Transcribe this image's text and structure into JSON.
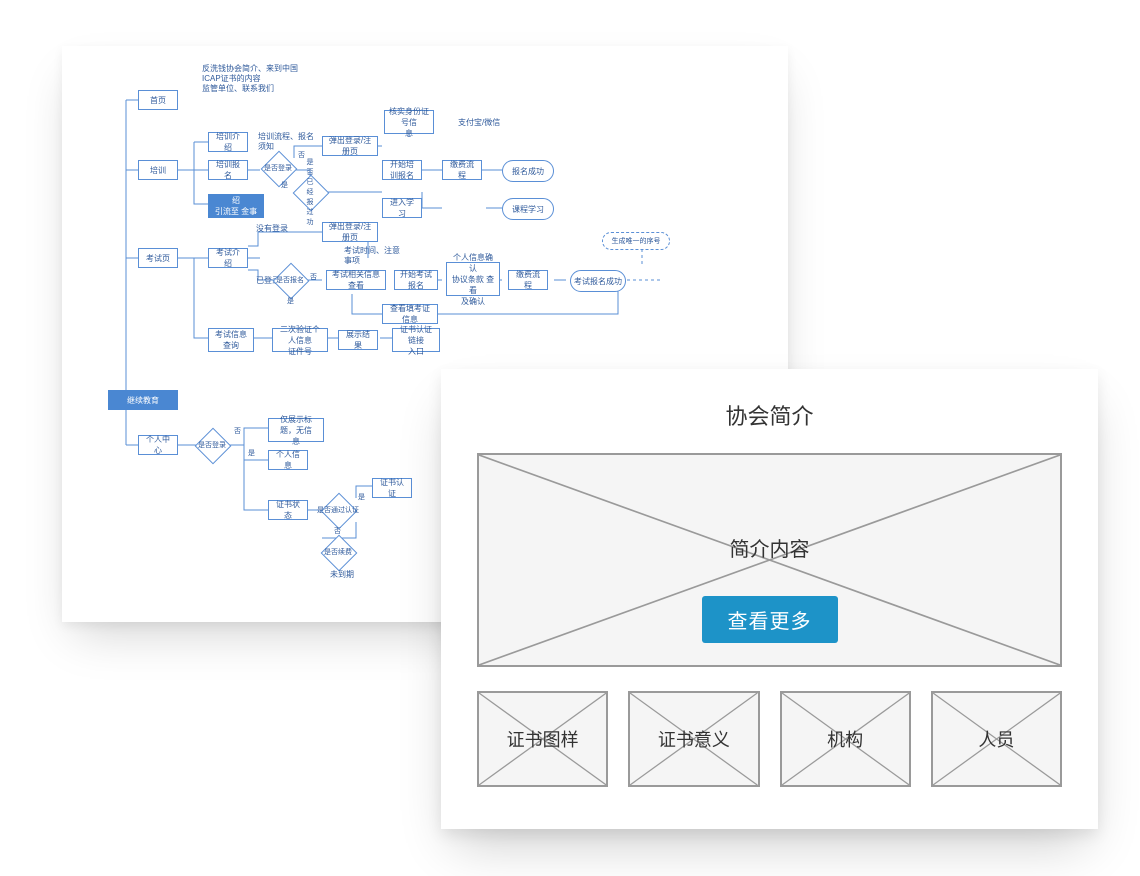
{
  "flowchart": {
    "note_top": "反洗钱协会简介、来到中国\nICAP证书的内容\n监管单位、联系我们",
    "nav": {
      "home": "首页",
      "training": "培训",
      "exam": "考试页",
      "continuing": "继续教育",
      "profile": "个人中心"
    },
    "training": {
      "intro": "培训介绍",
      "intro_note": "培训流程、报名\n须知",
      "signup": "培训报名",
      "is_login": "是否登录",
      "popup_login": "弹出登录/注册页",
      "has_signed": "是否已经报过\n功",
      "verify_id": "核实身份证号信\n息",
      "pay": "支付宝/微信",
      "start_train": "开始培训报名",
      "pay_flow": "缴费流程",
      "signup_ok": "报名成功",
      "enter_study": "进入学习",
      "course_study": "课程学习",
      "mock_exam": "模拟考试介绍\n引流至 金事件"
    },
    "exam": {
      "intro": "考试介绍",
      "not_logged": "没有登录",
      "logged": "已登录",
      "popup_login": "弹出登录/注册页",
      "time_note": "考试时间、注意\n事项",
      "has_signup": "是否报名",
      "info_view": "考试相关信息 查看",
      "start_signup": "开始考试报名",
      "confirm": "个人信息确认\n协议条款 查看\n及确认",
      "pay_flow": "缴费流程",
      "signup_ok": "考试报名成功",
      "serial": "生成唯一的序号",
      "review": "查看填考证信息",
      "info_query": "考试信息查询",
      "verify_id": "二次验证个人信息\n证件号",
      "show_result": "展示结果",
      "cert_entry": "证书认证链接\n入口"
    },
    "profile": {
      "is_login": "是否登录",
      "only_title": "仅展示标题，无信\n息",
      "info": "个人信息",
      "cert_status": "证书状态",
      "is_cert": "是否通过认证",
      "cert_auth": "证书认证",
      "need_renew": "是否续费",
      "not_due": "未到期"
    },
    "glyph": {
      "yes": "是",
      "no": "否"
    }
  },
  "wireframe": {
    "title": "协会简介",
    "hero_label": "简介内容",
    "cta": "查看更多",
    "tiles": [
      "证书图样",
      "证书意义",
      "机构",
      "人员"
    ]
  }
}
